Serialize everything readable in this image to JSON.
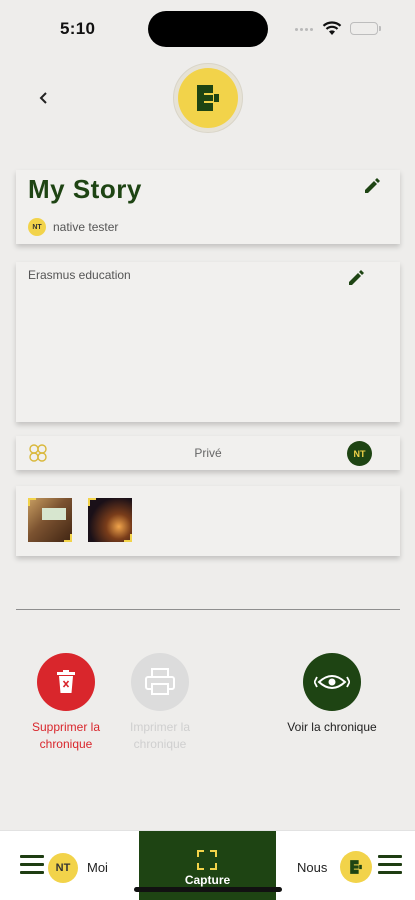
{
  "status_bar": {
    "time": "5:10"
  },
  "story": {
    "title": "My Story",
    "author_initials": "NT",
    "author_name": "native tester",
    "description": "Erasmus education"
  },
  "privacy": {
    "label": "Privé",
    "member_initials": "NT"
  },
  "actions": {
    "delete_label": "Supprimer la chronique",
    "print_label": "Imprimer la chronique",
    "view_label": "Voir la chronique"
  },
  "tab_bar": {
    "moi_initials": "NT",
    "moi_label": "Moi",
    "capture_label": "Capture",
    "nous_label": "Nous"
  },
  "colors": {
    "brand_green": "#1e4413",
    "brand_yellow": "#f2d34a",
    "danger_red": "#d9262c",
    "disabled_gray": "#dcdcdc"
  },
  "icons": [
    "back-chevron-icon",
    "app-logo-icon",
    "edit-pencil-icon",
    "privacy-icon",
    "trash-icon",
    "printer-icon",
    "eye-icon",
    "menu-icon",
    "capture-icon"
  ]
}
